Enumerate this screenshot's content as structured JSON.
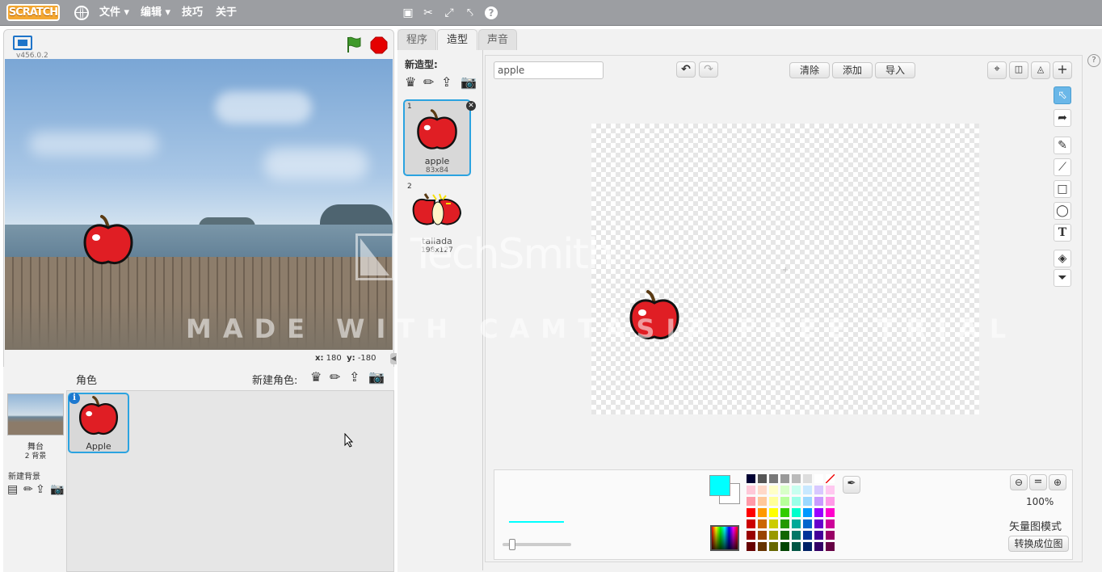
{
  "menubar": {
    "logo": "SCRATCH",
    "menus": [
      {
        "label": "文件 ▾",
        "icon": "globe-icon"
      },
      {
        "label": "编辑 ▾"
      },
      {
        "label": "技巧"
      },
      {
        "label": "关于"
      }
    ],
    "toolbar_icons": [
      "duplicate-stamp-icon",
      "cut-scissors-icon",
      "grow-icon",
      "shrink-icon",
      "help-icon"
    ]
  },
  "stage": {
    "version": "v456.0.2",
    "coords": {
      "x_label": "x:",
      "x": "180",
      "y_label": "y:",
      "y": "-180"
    }
  },
  "sprites": {
    "header": "角色",
    "new_sprite_label": "新建角色:",
    "stage_label": "舞台",
    "stage_backdrops": "2 背景",
    "new_backdrop_label": "新建背景",
    "items": [
      {
        "name": "Apple"
      }
    ]
  },
  "tabs": [
    "程序",
    "造型",
    "声音"
  ],
  "costumes": {
    "new_costume_label": "新造型:",
    "items": [
      {
        "index": "1",
        "name": "apple",
        "size": "83x84"
      },
      {
        "index": "2",
        "name": "tallada",
        "size": "198x127"
      }
    ]
  },
  "editor": {
    "costume_name": "apple",
    "buttons": {
      "clear": "清除",
      "add": "添加",
      "import": "导入"
    },
    "zoom": "100%",
    "mode_label": "矢量图模式",
    "convert_button": "转换成位图",
    "primary_color": "#00ffff",
    "secondary_color": "#ffffff",
    "palette": [
      [
        "#000033",
        "#555555",
        "#777777",
        "#999999",
        "#bbbbbb",
        "#dddddd",
        "#ffffff",
        "#ffffff"
      ],
      [
        "#ffc8d8",
        "#ffd8c8",
        "#ffffc8",
        "#d8ffc8",
        "#c8fff0",
        "#c8e8ff",
        "#d8c8ff",
        "#ffc8f0"
      ],
      [
        "#ff9aa8",
        "#ffc89a",
        "#ffff9a",
        "#b8ff9a",
        "#9affe8",
        "#9ad8ff",
        "#c89aff",
        "#ff9ae8"
      ],
      [
        "#ff0000",
        "#ff9900",
        "#ffff00",
        "#33cc00",
        "#00ffcc",
        "#0099ff",
        "#9900ff",
        "#ff00cc"
      ],
      [
        "#cc0000",
        "#cc6600",
        "#cccc00",
        "#229900",
        "#00aa99",
        "#0066cc",
        "#6600cc",
        "#cc0099"
      ],
      [
        "#990000",
        "#994400",
        "#999900",
        "#116600",
        "#007766",
        "#003399",
        "#440099",
        "#990066"
      ],
      [
        "#660000",
        "#663300",
        "#666600",
        "#004400",
        "#005544",
        "#002266",
        "#330066",
        "#660044"
      ]
    ]
  },
  "watermark": {
    "logo_text": "TechSmith",
    "line": "MADE WITH CAMTASIA FREE TRIAL"
  }
}
